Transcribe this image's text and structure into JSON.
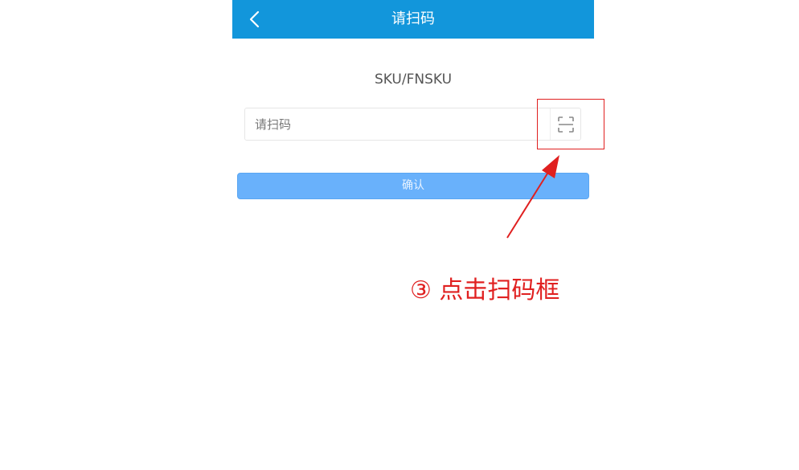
{
  "navbar": {
    "title": "请扫码",
    "back_icon": "chevron-left-icon",
    "background_color": "#1296db"
  },
  "form": {
    "field_label": "SKU/FNSKU",
    "input_placeholder": "请扫码",
    "input_value": "",
    "scan_icon": "scan-frame-icon",
    "confirm_label": "确认",
    "confirm_color": "#69b1fb"
  },
  "annotation": {
    "text": "③ 点击扫码框",
    "color": "#e02020"
  }
}
